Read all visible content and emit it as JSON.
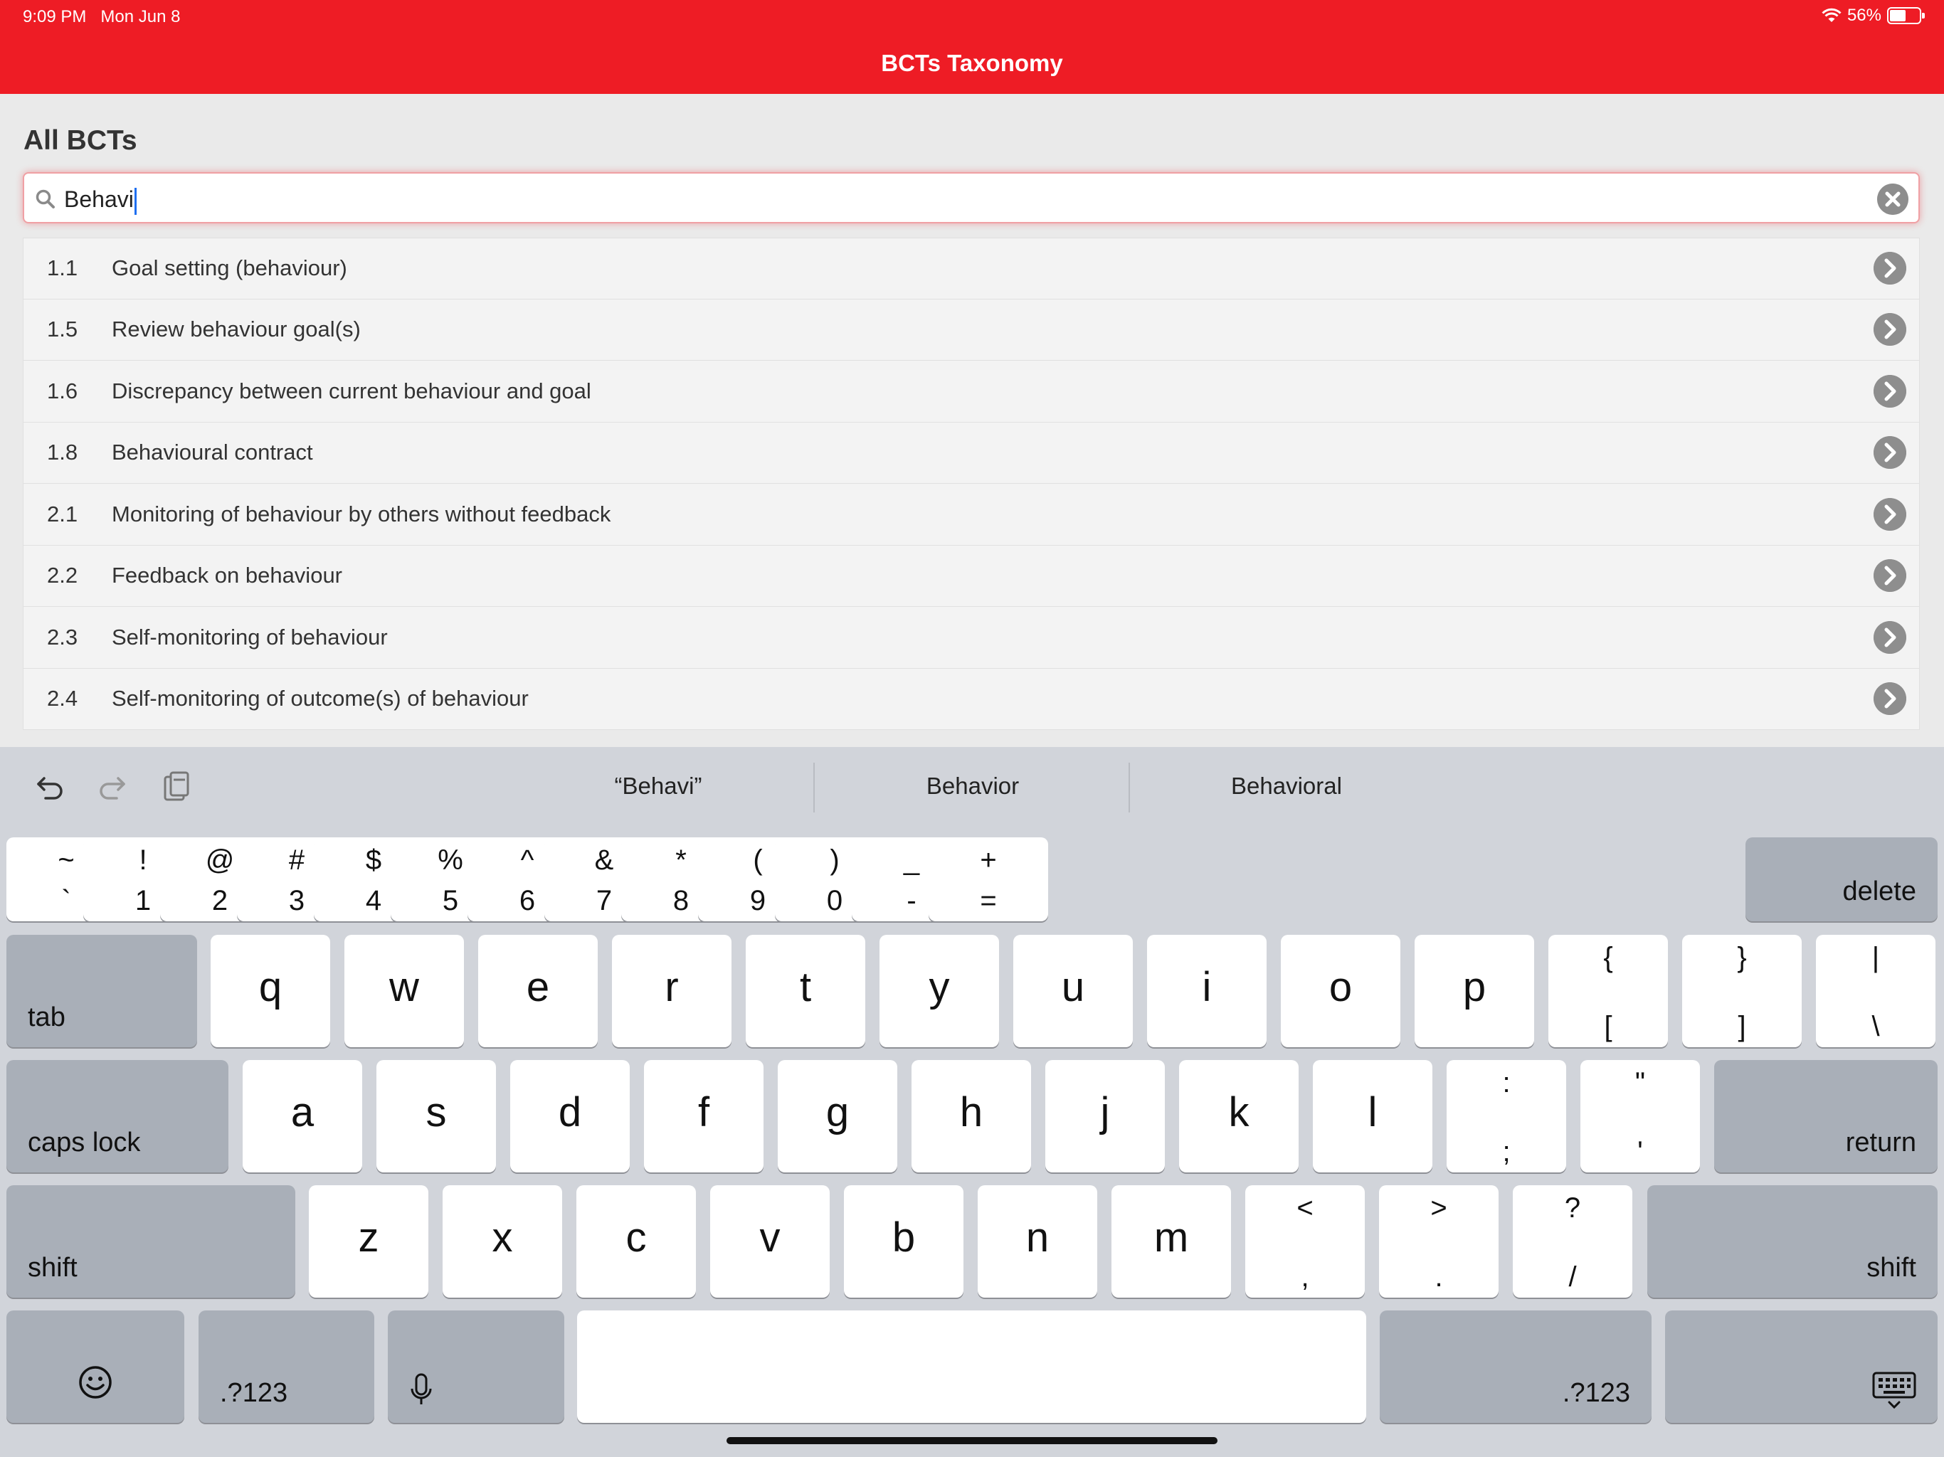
{
  "status": {
    "time": "9:09 PM",
    "date": "Mon Jun 8",
    "battery": "56%",
    "battery_level": 0.56
  },
  "app": {
    "title": "BCTs Taxonomy"
  },
  "section": {
    "title": "All BCTs"
  },
  "search": {
    "value": "Behavi"
  },
  "items": [
    {
      "num": "1.1",
      "label": "Goal setting (behaviour)"
    },
    {
      "num": "1.5",
      "label": "Review behaviour goal(s)"
    },
    {
      "num": "1.6",
      "label": "Discrepancy between current behaviour and goal"
    },
    {
      "num": "1.8",
      "label": "Behavioural contract"
    },
    {
      "num": "2.1",
      "label": "Monitoring of behaviour by others without feedback"
    },
    {
      "num": "2.2",
      "label": "Feedback on behaviour"
    },
    {
      "num": "2.3",
      "label": "Self-monitoring of behaviour"
    },
    {
      "num": "2.4",
      "label": "Self-monitoring of outcome(s) of behaviour"
    }
  ],
  "keyboard": {
    "suggestions": [
      "“Behavi”",
      "Behavior",
      "Behavioral"
    ],
    "row1": [
      {
        "top": "~",
        "bot": "`"
      },
      {
        "top": "!",
        "bot": "1"
      },
      {
        "top": "@",
        "bot": "2"
      },
      {
        "top": "#",
        "bot": "3"
      },
      {
        "top": "$",
        "bot": "4"
      },
      {
        "top": "%",
        "bot": "5"
      },
      {
        "top": "^",
        "bot": "6"
      },
      {
        "top": "&",
        "bot": "7"
      },
      {
        "top": "*",
        "bot": "8"
      },
      {
        "top": "(",
        "bot": "9"
      },
      {
        "top": ")",
        "bot": "0"
      },
      {
        "top": "_",
        "bot": "-"
      },
      {
        "top": "+",
        "bot": "="
      }
    ],
    "delete_label": "delete",
    "tab_label": "tab",
    "row2": [
      "q",
      "w",
      "e",
      "r",
      "t",
      "y",
      "u",
      "i",
      "o",
      "p"
    ],
    "row2_sym": [
      {
        "top": "{",
        "bot": "["
      },
      {
        "top": "}",
        "bot": "]"
      },
      {
        "top": "|",
        "bot": "\\"
      }
    ],
    "caps_label": "caps lock",
    "row3": [
      "a",
      "s",
      "d",
      "f",
      "g",
      "h",
      "j",
      "k",
      "l"
    ],
    "row3_sym": [
      {
        "top": ":",
        "bot": ";"
      },
      {
        "top": "\"",
        "bot": "'"
      }
    ],
    "return_label": "return",
    "shift_label": "shift",
    "row4": [
      "z",
      "x",
      "c",
      "v",
      "b",
      "n",
      "m"
    ],
    "row4_sym": [
      {
        "top": "<",
        "bot": ","
      },
      {
        "top": ">",
        "bot": "."
      },
      {
        "top": "?",
        "bot": "/"
      }
    ],
    "numbers_label": ".?123"
  }
}
